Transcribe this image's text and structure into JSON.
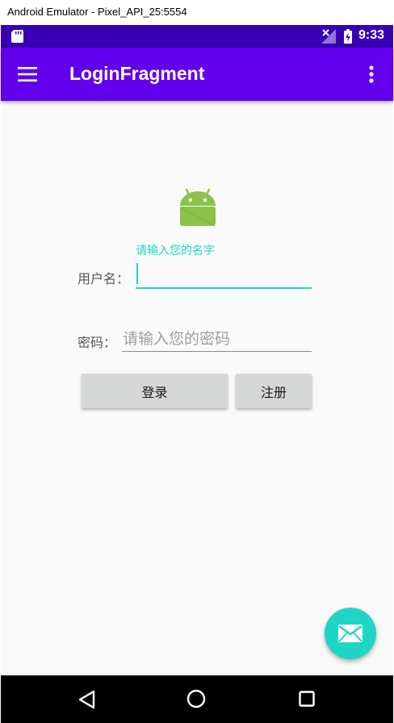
{
  "window": {
    "title": "Android Emulator - Pixel_API_25:5554"
  },
  "status_bar": {
    "time": "9:33",
    "icons": [
      "sd-card-icon",
      "signal-off-icon",
      "battery-charging-icon"
    ]
  },
  "app_bar": {
    "title": "LoginFragment",
    "icons": [
      "menu-icon",
      "overflow-menu-icon"
    ]
  },
  "form": {
    "logo_icon": "android-robot-icon",
    "username": {
      "label": "用户名：",
      "floating_hint": "请输入您的名字",
      "value": ""
    },
    "password": {
      "label": "密码：",
      "placeholder": "请输入您的密码",
      "value": ""
    },
    "login_button": "登录",
    "register_button": "注册"
  },
  "fab": {
    "icon": "email-icon"
  },
  "nav_bar": {
    "icons": [
      "back-icon",
      "home-icon",
      "recents-icon"
    ]
  },
  "colors": {
    "status_bar": "#3700b3",
    "app_bar": "#6200ee",
    "accent": "#1fd5c5",
    "button": "#d6d7d7",
    "nav_bar": "#000000"
  }
}
